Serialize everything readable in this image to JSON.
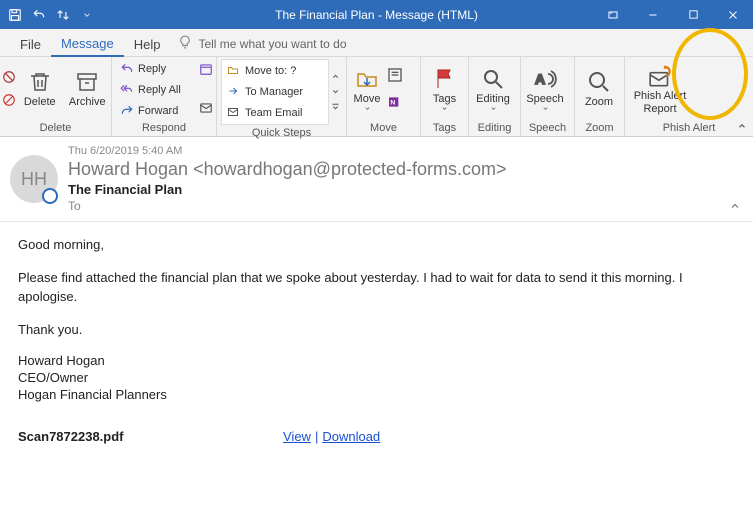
{
  "window": {
    "title": "The Financial Plan  -  Message (HTML)"
  },
  "tabs": {
    "file": "File",
    "message": "Message",
    "help": "Help",
    "tellme": "Tell me what you want to do"
  },
  "ribbon": {
    "delete_group": "Delete",
    "delete": "Delete",
    "archive": "Archive",
    "respond_group": "Respond",
    "reply": "Reply",
    "reply_all": "Reply All",
    "forward": "Forward",
    "quicksteps_group": "Quick Steps",
    "move_to": "Move to: ?",
    "to_manager": "To Manager",
    "team_email": "Team Email",
    "move_group": "Move",
    "move": "Move",
    "tags_group": "Tags",
    "tags": "Tags",
    "editing_group": "Editing",
    "editing": "Editing",
    "speech_group": "Speech",
    "speech": "Speech",
    "zoom_group": "Zoom",
    "zoom": "Zoom",
    "phish_group": "Phish Alert",
    "phish": "Phish Alert Report"
  },
  "email": {
    "avatar_initials": "HH",
    "date": "Thu 6/20/2019 5:40 AM",
    "from_display": "Howard Hogan <howardhogan@protected-forms.com>",
    "subject": "The Financial Plan",
    "to_label": "To",
    "body_p1": "Good morning,",
    "body_p2": "Please find attached the financial plan that we spoke about yesterday. I had to wait for data to send it this morning. I apologise.",
    "body_p3": "Thank you.",
    "sig_name": "Howard Hogan",
    "sig_title": "CEO/Owner",
    "sig_company": "Hogan Financial Planners",
    "attachment_name": "Scan7872238.pdf",
    "view": "View",
    "download": "Download"
  }
}
